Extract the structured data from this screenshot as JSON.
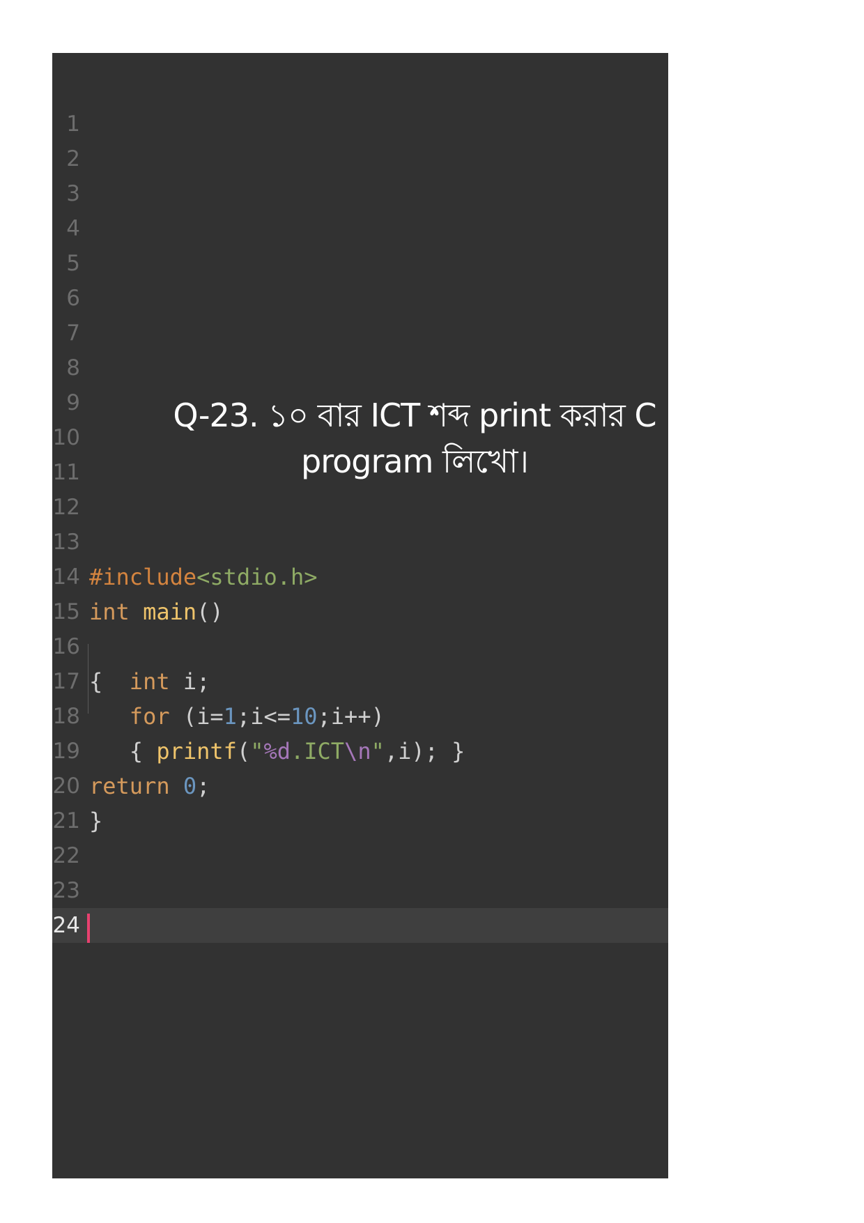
{
  "title_line1": "Q-23. ১০ বার ICT শব্দ print করার C",
  "title_line2": "program লিখো।",
  "line_numbers": [
    "1",
    "2",
    "3",
    "4",
    "5",
    "6",
    "7",
    "8",
    "9",
    "10",
    "11",
    "12",
    "13",
    "14",
    "15",
    "16",
    "17",
    "18",
    "19",
    "20",
    "21",
    "22",
    "23",
    "24"
  ],
  "code": {
    "l14": {
      "include": "#include",
      "header": "<stdio.h>"
    },
    "l15": {
      "type": "int",
      "fn": "main",
      "parens": "()"
    },
    "l17": {
      "brace": "{",
      "type": "int",
      "rest": "i;"
    },
    "l18": {
      "kw": "for",
      "p1": "(i=",
      "n1": "1",
      "p2": ";i<=",
      "n2": "10",
      "p3": ";i++)"
    },
    "l19": {
      "brace": "{",
      "fn": "printf",
      "p1": "(",
      "q1": "\"",
      "fmt": "%d",
      "txt": ".ICT",
      "esc": "\\n",
      "q2": "\"",
      "p2": ",i);",
      "close": "}"
    },
    "l20": {
      "kw": "return",
      "num": "0",
      "semi": ";"
    },
    "l21": {
      "brace": "}"
    }
  },
  "active_line": "24",
  "colors": {
    "editor_bg": "#323232",
    "keyword": "#d59a5c",
    "function": "#efc46b",
    "number": "#6b96c0",
    "string": "#8fab65",
    "escape": "#a577b9",
    "cursor": "#e8416f"
  }
}
